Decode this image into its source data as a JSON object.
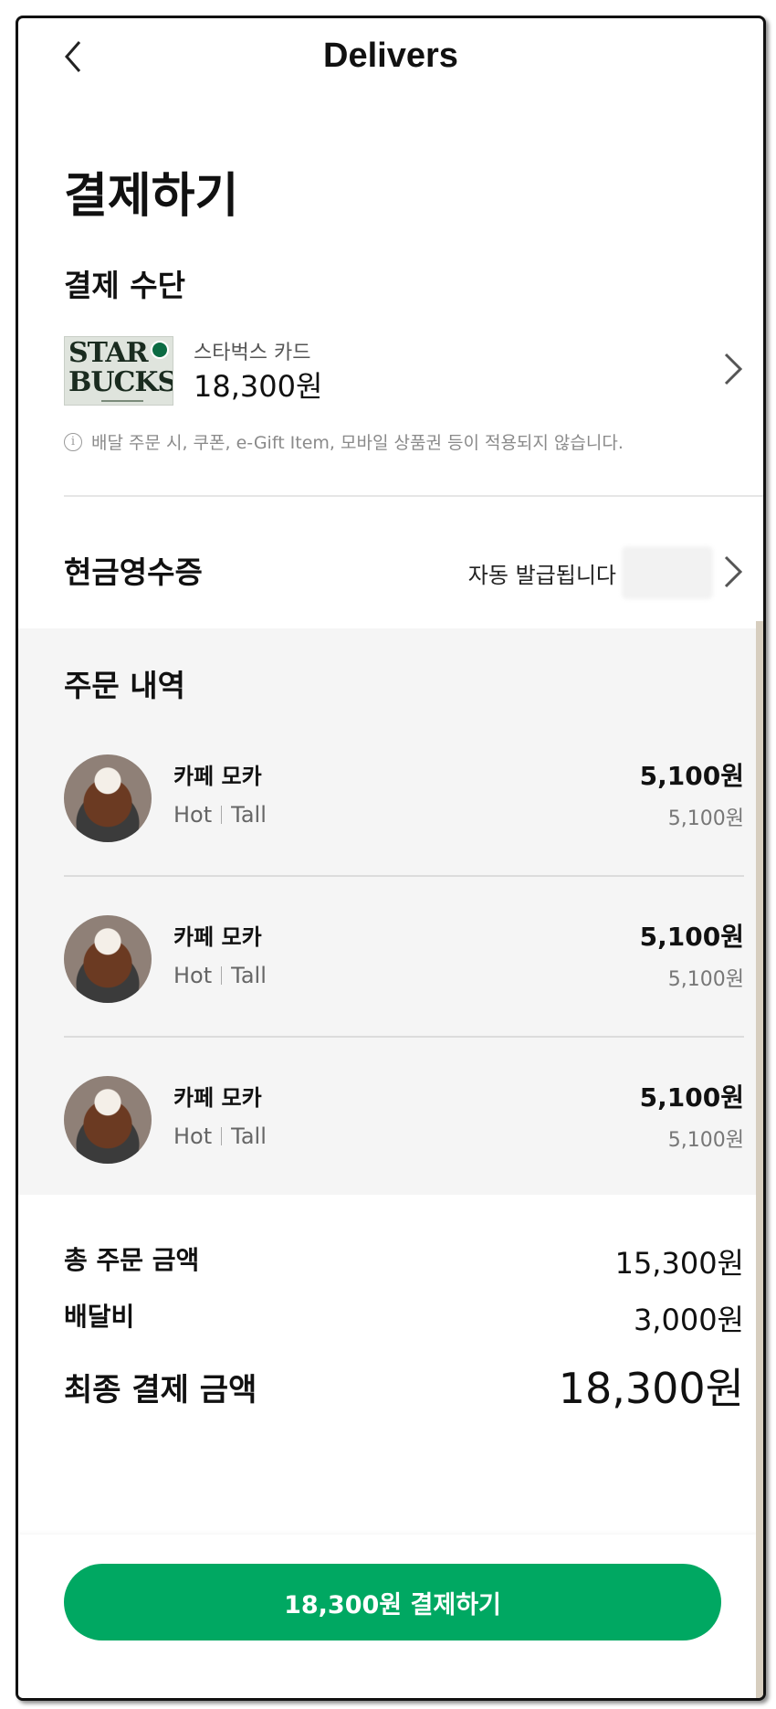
{
  "header": {
    "title": "Delivers",
    "back_icon": "chevron-left-icon"
  },
  "page_title": "결제하기",
  "payment": {
    "section_label": "결제 수단",
    "card_name": "스타벅스 카드",
    "card_amount": "18,300원",
    "card_image_text": [
      "STAR",
      "BUCKS"
    ],
    "notice": "배달 주문 시, 쿠폰, e-Gift Item, 모바일 상품권 등이 적용되지 않습니다."
  },
  "receipt": {
    "label": "현금영수증",
    "status": "자동 발급됩니다"
  },
  "orders": {
    "title": "주문 내역",
    "items": [
      {
        "name": "카페 모카",
        "temp": "Hot",
        "size": "Tall",
        "price": "5,100원",
        "unit_price": "5,100원"
      },
      {
        "name": "카페 모카",
        "temp": "Hot",
        "size": "Tall",
        "price": "5,100원",
        "unit_price": "5,100원"
      },
      {
        "name": "카페 모카",
        "temp": "Hot",
        "size": "Tall",
        "price": "5,100원",
        "unit_price": "5,100원"
      }
    ]
  },
  "totals": {
    "order_total_label": "총 주문 금액",
    "order_total_value": "15,300원",
    "delivery_fee_label": "배달비",
    "delivery_fee_value": "3,000원",
    "final_label": "최종 결제 금액",
    "final_value": "18,300원"
  },
  "pay_button": {
    "label": "18,300원 결제하기"
  },
  "colors": {
    "accent": "#00a862",
    "list_bg": "#f5f5f5"
  }
}
